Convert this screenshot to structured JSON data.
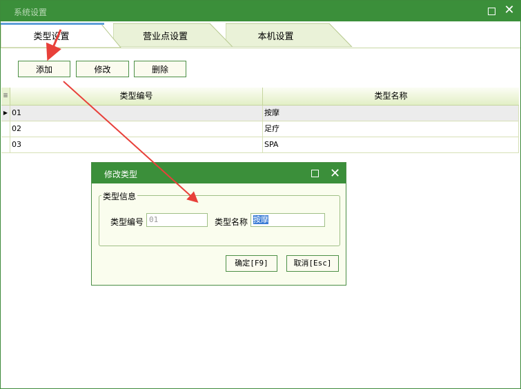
{
  "window": {
    "title": "系统设置"
  },
  "tabs": [
    {
      "label": "类型设置",
      "active": true
    },
    {
      "label": "营业点设置",
      "active": false
    },
    {
      "label": "本机设置",
      "active": false
    }
  ],
  "toolbar": {
    "add_label": "添加",
    "edit_label": "修改",
    "delete_label": "删除"
  },
  "grid": {
    "columns": [
      "类型编号",
      "类型名称"
    ],
    "rows": [
      {
        "code": "01",
        "name": "按摩"
      },
      {
        "code": "02",
        "name": "足疗"
      },
      {
        "code": "03",
        "name": "SPA"
      }
    ]
  },
  "dialog": {
    "title": "修改类型",
    "group_label": "类型信息",
    "code_label": "类型编号",
    "code_value": "01",
    "name_label": "类型名称",
    "name_value": "按摩",
    "ok_label": "确定[F9]",
    "cancel_label": "取消[Esc]"
  },
  "colors": {
    "title_bar": "#3b8f3a",
    "annotation_arrow": "#e8403a"
  }
}
